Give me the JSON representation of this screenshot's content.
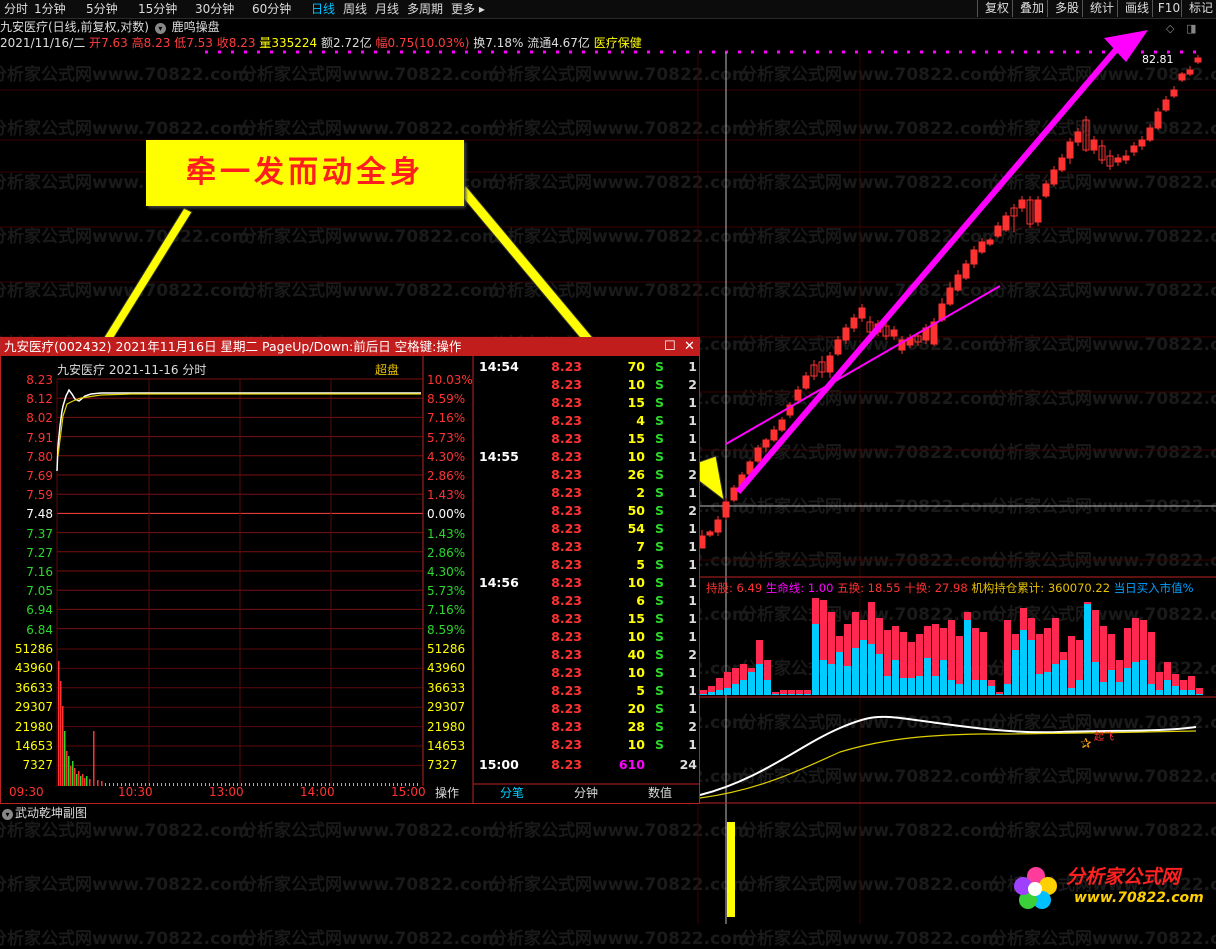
{
  "toolbar": {
    "periods": [
      "分时",
      "1分钟",
      "5分钟",
      "15分钟",
      "30分钟",
      "60分钟",
      "日线",
      "周线",
      "月线",
      "多周期",
      "更多"
    ],
    "active_period": "日线",
    "right_buttons": [
      "复权",
      "叠加",
      "多股",
      "统计",
      "画线",
      "F10",
      "标记"
    ]
  },
  "header": {
    "stock_line": "九安医疗(日线,前复权,对数)",
    "indicator_name": "鹿鸣操盘",
    "date": "2021/11/16/二",
    "open_label": "开",
    "open": "7.63",
    "high_label": "高",
    "high": "8.23",
    "low_label": "低",
    "low": "7.53",
    "close_label": "收",
    "close": "8.23",
    "volume_label": "量",
    "volume": "335224",
    "amount_label": "额",
    "amount": "2.72亿",
    "change_label": "幅",
    "change": "0.75(10.03%)",
    "turnover_label": "换",
    "turnover": "7.18%",
    "float_label": "流通",
    "float_cap": "4.67亿",
    "sector": "医疗保健"
  },
  "kline": {
    "peak_label": "82.81",
    "colors": {
      "up": "#ff3232",
      "down": "#00ffff",
      "arrow": "#ff00ff"
    }
  },
  "indicator_bar": {
    "items": [
      {
        "label": "持股: 6.49",
        "color": "#ff3232"
      },
      {
        "label": "生命线: 1.00",
        "color": "#ff00ff"
      },
      {
        "label": "五换: 18.55",
        "color": "#ff3232"
      },
      {
        "label": "十换: 27.98",
        "color": "#ff3232"
      },
      {
        "label": "机构持仓累计: 360070.22",
        "color": "#e8c200"
      },
      {
        "label": "当日买入市值%",
        "color": "#00a0ff"
      }
    ],
    "signal_label": "起飞"
  },
  "banner": {
    "text": "牵一发而动全身"
  },
  "popup": {
    "title": "九安医疗(002432) 2021年11月16日 星期二 PageUp/Down:前后日 空格键:操作",
    "chart_header": "九安医疗  2021-11-16 分时",
    "tag": "超盘",
    "left_prices": [
      "8.23",
      "8.12",
      "8.02",
      "7.91",
      "7.80",
      "7.69",
      "7.59",
      "7.48",
      "7.37",
      "7.27",
      "7.16",
      "7.05",
      "6.94",
      "6.84"
    ],
    "right_pcts": [
      "10.03%",
      "8.59%",
      "7.16%",
      "5.73%",
      "4.30%",
      "2.86%",
      "1.43%",
      "0.00%",
      "1.43%",
      "2.86%",
      "4.30%",
      "5.73%",
      "7.16%",
      "8.59%"
    ],
    "vol_labels": [
      "51286",
      "43960",
      "36633",
      "29307",
      "21980",
      "14653",
      "7327"
    ],
    "time_labels": [
      "09:30",
      "10:30",
      "13:00",
      "14:00",
      "15:00"
    ],
    "ticks": [
      {
        "time": "14:54",
        "price": "8.23",
        "vol": "70",
        "side": "S",
        "n": "1"
      },
      {
        "time": "",
        "price": "8.23",
        "vol": "10",
        "side": "S",
        "n": "2"
      },
      {
        "time": "",
        "price": "8.23",
        "vol": "15",
        "side": "S",
        "n": "1"
      },
      {
        "time": "",
        "price": "8.23",
        "vol": "4",
        "side": "S",
        "n": "1"
      },
      {
        "time": "",
        "price": "8.23",
        "vol": "15",
        "side": "S",
        "n": "1"
      },
      {
        "time": "14:55",
        "price": "8.23",
        "vol": "10",
        "side": "S",
        "n": "1"
      },
      {
        "time": "",
        "price": "8.23",
        "vol": "26",
        "side": "S",
        "n": "2"
      },
      {
        "time": "",
        "price": "8.23",
        "vol": "2",
        "side": "S",
        "n": "1"
      },
      {
        "time": "",
        "price": "8.23",
        "vol": "50",
        "side": "S",
        "n": "2"
      },
      {
        "time": "",
        "price": "8.23",
        "vol": "54",
        "side": "S",
        "n": "1"
      },
      {
        "time": "",
        "price": "8.23",
        "vol": "7",
        "side": "S",
        "n": "1"
      },
      {
        "time": "",
        "price": "8.23",
        "vol": "5",
        "side": "S",
        "n": "1"
      },
      {
        "time": "14:56",
        "price": "8.23",
        "vol": "10",
        "side": "S",
        "n": "1"
      },
      {
        "time": "",
        "price": "8.23",
        "vol": "6",
        "side": "S",
        "n": "1"
      },
      {
        "time": "",
        "price": "8.23",
        "vol": "15",
        "side": "S",
        "n": "1"
      },
      {
        "time": "",
        "price": "8.23",
        "vol": "10",
        "side": "S",
        "n": "1"
      },
      {
        "time": "",
        "price": "8.23",
        "vol": "40",
        "side": "S",
        "n": "2"
      },
      {
        "time": "",
        "price": "8.23",
        "vol": "10",
        "side": "S",
        "n": "1"
      },
      {
        "time": "",
        "price": "8.23",
        "vol": "5",
        "side": "S",
        "n": "1"
      },
      {
        "time": "",
        "price": "8.23",
        "vol": "20",
        "side": "S",
        "n": "1"
      },
      {
        "time": "",
        "price": "8.23",
        "vol": "28",
        "side": "S",
        "n": "2"
      },
      {
        "time": "",
        "price": "8.23",
        "vol": "10",
        "side": "S",
        "n": "1"
      },
      {
        "time": "15:00",
        "price": "8.23",
        "vol": "610",
        "side": "",
        "n": "24"
      }
    ],
    "tabs": [
      "操作",
      "分笔",
      "分钟",
      "数值"
    ],
    "active_tab": "分笔"
  },
  "sub_chart": {
    "title": "武动乾坤副图"
  },
  "watermark": "分析家公式网www.70822.com",
  "logo": {
    "title": "分析家公式网",
    "url": "www.70822.com"
  }
}
